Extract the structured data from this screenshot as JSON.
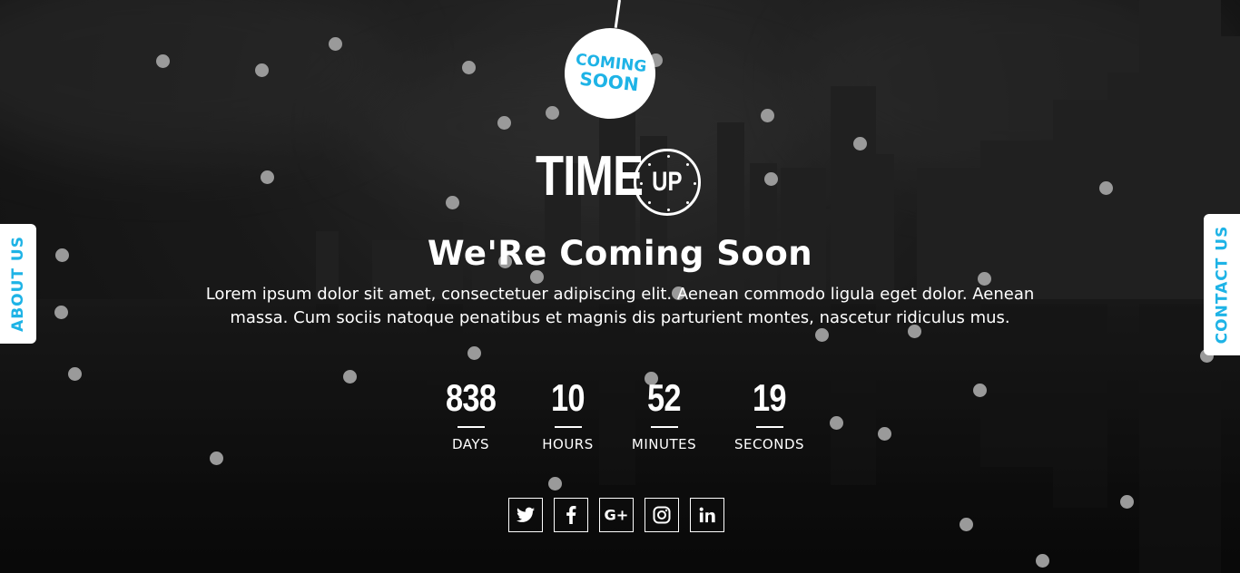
{
  "badge": {
    "line1": "COMING",
    "line2": "SOON"
  },
  "logo": {
    "word": "TIME",
    "clock_text": "UP"
  },
  "heading": "We'Re Coming Soon",
  "description": "Lorem ipsum dolor sit amet, consectetuer adipiscing elit. Aenean commodo ligula eget dolor. Aenean massa. Cum sociis natoque penatibus et magnis dis parturient montes, nascetur ridiculus mus.",
  "countdown": [
    {
      "value": "838",
      "label": "DAYS"
    },
    {
      "value": "10",
      "label": "HOURS"
    },
    {
      "value": "52",
      "label": "MINUTES"
    },
    {
      "value": "19",
      "label": "SECONDS"
    }
  ],
  "socials": [
    "twitter-icon",
    "facebook-icon",
    "google-plus-icon",
    "instagram-icon",
    "linkedin-icon"
  ],
  "side_tabs": {
    "left": "ABOUT US",
    "right": "CONTACT US"
  },
  "colors": {
    "accent": "#1eb3e6",
    "text": "#ffffff",
    "dot": "#9a9a9a"
  }
}
